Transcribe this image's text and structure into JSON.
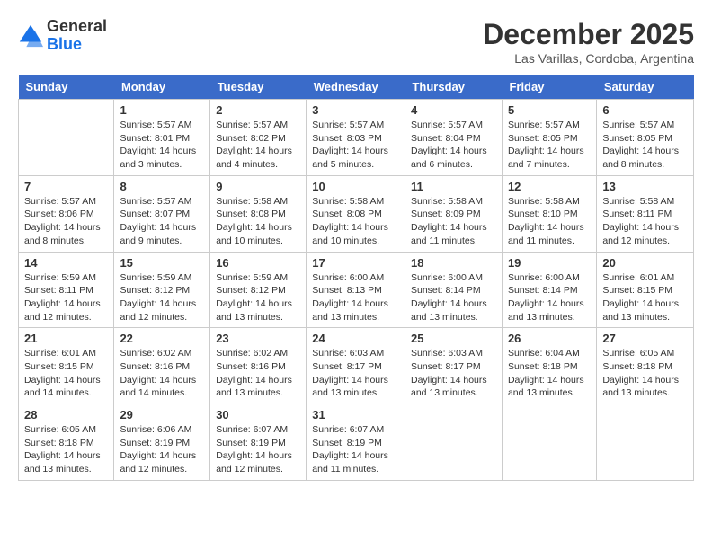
{
  "logo": {
    "general": "General",
    "blue": "Blue"
  },
  "title": {
    "month_year": "December 2025",
    "location": "Las Varillas, Cordoba, Argentina"
  },
  "weekdays": [
    "Sunday",
    "Monday",
    "Tuesday",
    "Wednesday",
    "Thursday",
    "Friday",
    "Saturday"
  ],
  "weeks": [
    [
      {
        "day": "",
        "info": ""
      },
      {
        "day": "1",
        "info": "Sunrise: 5:57 AM\nSunset: 8:01 PM\nDaylight: 14 hours\nand 3 minutes."
      },
      {
        "day": "2",
        "info": "Sunrise: 5:57 AM\nSunset: 8:02 PM\nDaylight: 14 hours\nand 4 minutes."
      },
      {
        "day": "3",
        "info": "Sunrise: 5:57 AM\nSunset: 8:03 PM\nDaylight: 14 hours\nand 5 minutes."
      },
      {
        "day": "4",
        "info": "Sunrise: 5:57 AM\nSunset: 8:04 PM\nDaylight: 14 hours\nand 6 minutes."
      },
      {
        "day": "5",
        "info": "Sunrise: 5:57 AM\nSunset: 8:05 PM\nDaylight: 14 hours\nand 7 minutes."
      },
      {
        "day": "6",
        "info": "Sunrise: 5:57 AM\nSunset: 8:05 PM\nDaylight: 14 hours\nand 8 minutes."
      }
    ],
    [
      {
        "day": "7",
        "info": "Sunrise: 5:57 AM\nSunset: 8:06 PM\nDaylight: 14 hours\nand 8 minutes."
      },
      {
        "day": "8",
        "info": "Sunrise: 5:57 AM\nSunset: 8:07 PM\nDaylight: 14 hours\nand 9 minutes."
      },
      {
        "day": "9",
        "info": "Sunrise: 5:58 AM\nSunset: 8:08 PM\nDaylight: 14 hours\nand 10 minutes."
      },
      {
        "day": "10",
        "info": "Sunrise: 5:58 AM\nSunset: 8:08 PM\nDaylight: 14 hours\nand 10 minutes."
      },
      {
        "day": "11",
        "info": "Sunrise: 5:58 AM\nSunset: 8:09 PM\nDaylight: 14 hours\nand 11 minutes."
      },
      {
        "day": "12",
        "info": "Sunrise: 5:58 AM\nSunset: 8:10 PM\nDaylight: 14 hours\nand 11 minutes."
      },
      {
        "day": "13",
        "info": "Sunrise: 5:58 AM\nSunset: 8:11 PM\nDaylight: 14 hours\nand 12 minutes."
      }
    ],
    [
      {
        "day": "14",
        "info": "Sunrise: 5:59 AM\nSunset: 8:11 PM\nDaylight: 14 hours\nand 12 minutes."
      },
      {
        "day": "15",
        "info": "Sunrise: 5:59 AM\nSunset: 8:12 PM\nDaylight: 14 hours\nand 12 minutes."
      },
      {
        "day": "16",
        "info": "Sunrise: 5:59 AM\nSunset: 8:12 PM\nDaylight: 14 hours\nand 13 minutes."
      },
      {
        "day": "17",
        "info": "Sunrise: 6:00 AM\nSunset: 8:13 PM\nDaylight: 14 hours\nand 13 minutes."
      },
      {
        "day": "18",
        "info": "Sunrise: 6:00 AM\nSunset: 8:14 PM\nDaylight: 14 hours\nand 13 minutes."
      },
      {
        "day": "19",
        "info": "Sunrise: 6:00 AM\nSunset: 8:14 PM\nDaylight: 14 hours\nand 13 minutes."
      },
      {
        "day": "20",
        "info": "Sunrise: 6:01 AM\nSunset: 8:15 PM\nDaylight: 14 hours\nand 13 minutes."
      }
    ],
    [
      {
        "day": "21",
        "info": "Sunrise: 6:01 AM\nSunset: 8:15 PM\nDaylight: 14 hours\nand 14 minutes."
      },
      {
        "day": "22",
        "info": "Sunrise: 6:02 AM\nSunset: 8:16 PM\nDaylight: 14 hours\nand 14 minutes."
      },
      {
        "day": "23",
        "info": "Sunrise: 6:02 AM\nSunset: 8:16 PM\nDaylight: 14 hours\nand 13 minutes."
      },
      {
        "day": "24",
        "info": "Sunrise: 6:03 AM\nSunset: 8:17 PM\nDaylight: 14 hours\nand 13 minutes."
      },
      {
        "day": "25",
        "info": "Sunrise: 6:03 AM\nSunset: 8:17 PM\nDaylight: 14 hours\nand 13 minutes."
      },
      {
        "day": "26",
        "info": "Sunrise: 6:04 AM\nSunset: 8:18 PM\nDaylight: 14 hours\nand 13 minutes."
      },
      {
        "day": "27",
        "info": "Sunrise: 6:05 AM\nSunset: 8:18 PM\nDaylight: 14 hours\nand 13 minutes."
      }
    ],
    [
      {
        "day": "28",
        "info": "Sunrise: 6:05 AM\nSunset: 8:18 PM\nDaylight: 14 hours\nand 13 minutes."
      },
      {
        "day": "29",
        "info": "Sunrise: 6:06 AM\nSunset: 8:19 PM\nDaylight: 14 hours\nand 12 minutes."
      },
      {
        "day": "30",
        "info": "Sunrise: 6:07 AM\nSunset: 8:19 PM\nDaylight: 14 hours\nand 12 minutes."
      },
      {
        "day": "31",
        "info": "Sunrise: 6:07 AM\nSunset: 8:19 PM\nDaylight: 14 hours\nand 11 minutes."
      },
      {
        "day": "",
        "info": ""
      },
      {
        "day": "",
        "info": ""
      },
      {
        "day": "",
        "info": ""
      }
    ]
  ]
}
